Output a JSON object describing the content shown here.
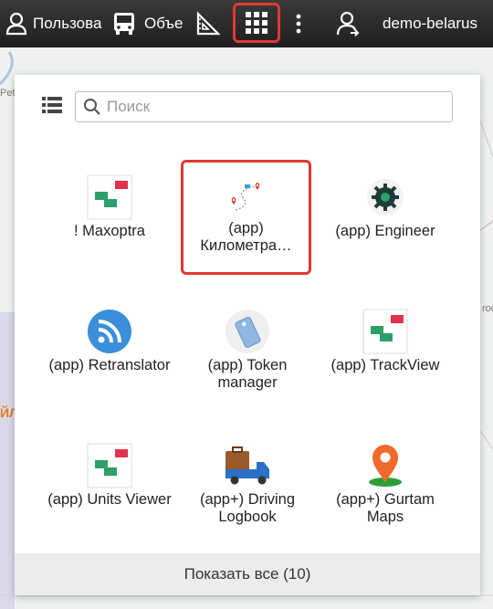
{
  "topbar": {
    "users_label": "Пользова",
    "objects_label": "Объе",
    "account_label": "demo-belarus"
  },
  "map": {
    "label_left": "Petr",
    "label_right": "rod",
    "label_orange": "ЙЛ"
  },
  "panel": {
    "search_placeholder": "Поиск",
    "apps": [
      {
        "label": "! Maxoptra",
        "icon": "maxoptra-icon"
      },
      {
        "label": "(app) Километра…",
        "icon": "route-icon"
      },
      {
        "label": "(app) Engineer",
        "icon": "gear-icon"
      },
      {
        "label": "(app) Retranslator",
        "icon": "rss-icon"
      },
      {
        "label": "(app) Token manager",
        "icon": "tag-icon"
      },
      {
        "label": "(app) TrackView",
        "icon": "trackview-icon"
      },
      {
        "label": "(app) Units Viewer",
        "icon": "units-viewer-icon"
      },
      {
        "label": "(app+) Driving Logbook",
        "icon": "truck-icon"
      },
      {
        "label": "(app+) Gurtam Maps",
        "icon": "map-pin-icon"
      }
    ],
    "show_all_label": "Показать все (10)"
  },
  "colors": {
    "topbar": "#2a2a2a",
    "accent_red": "#e03a32",
    "green": "#2e9e6a"
  }
}
